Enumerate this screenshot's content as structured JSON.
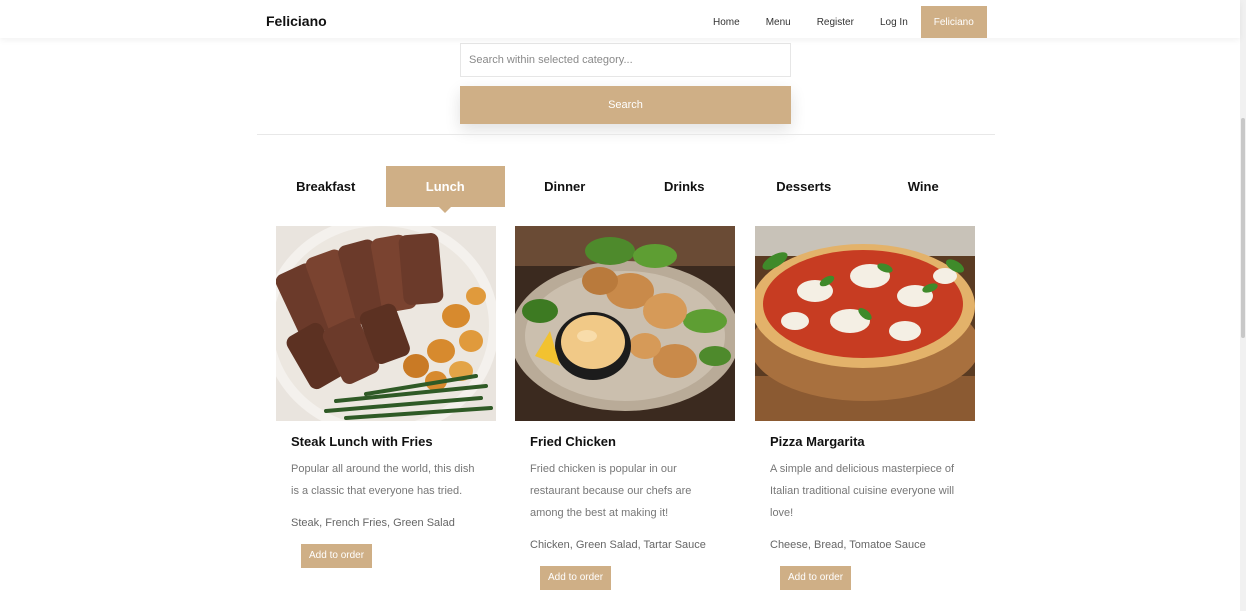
{
  "brand": "Feliciano",
  "nav": {
    "items": [
      "Home",
      "Menu",
      "Register",
      "Log In"
    ],
    "user": "Feliciano"
  },
  "search": {
    "placeholder": "Search within selected category...",
    "button_label": "Search"
  },
  "tabs": [
    "Breakfast",
    "Lunch",
    "Dinner",
    "Drinks",
    "Desserts",
    "Wine"
  ],
  "active_tab": "Lunch",
  "cards": [
    {
      "image": "steak-image",
      "title": "Steak Lunch with Fries",
      "description": "Popular all around the world, this dish is a classic that everyone has tried.",
      "ingredients": "Steak, French Fries, Green Salad",
      "button": "Add to order"
    },
    {
      "image": "fried-chicken-image",
      "title": "Fried Chicken",
      "description": "Fried chicken is popular in our restaurant because our chefs are among the best at making it!",
      "ingredients": "Chicken, Green Salad, Tartar Sauce",
      "button": "Add to order"
    },
    {
      "image": "pizza-image",
      "title": "Pizza Margarita",
      "description": "A simple and delicious masterpiece of Italian traditional cuisine everyone will love!",
      "ingredients": "Cheese, Bread, Tomatoe Sauce",
      "button": "Add to order"
    }
  ],
  "colors": {
    "accent": "#cfaf86",
    "text": "#111111",
    "muted": "#777777"
  }
}
